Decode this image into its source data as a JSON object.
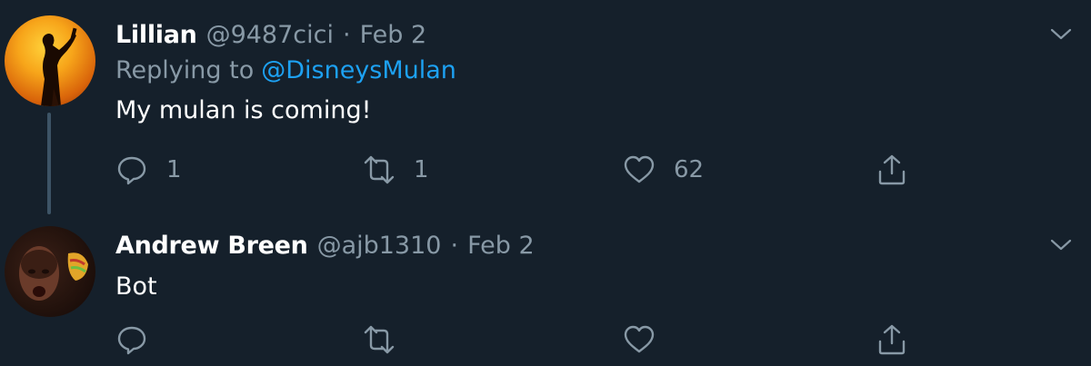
{
  "tweets": [
    {
      "display_name": "Lillian",
      "handle": "@9487cici",
      "separator": "·",
      "date": "Feb 2",
      "replying_prefix": "Replying to",
      "replying_to": "@DisneysMulan",
      "text": "My mulan is coming!",
      "reply_count": "1",
      "retweet_count": "1",
      "like_count": "62"
    },
    {
      "display_name": "Andrew Breen",
      "handle": "@ajb1310",
      "separator": "·",
      "date": "Feb 2",
      "text": "Bot"
    }
  ],
  "icons": {
    "reply": "reply-icon",
    "retweet": "retweet-icon",
    "like": "heart-icon",
    "share": "share-icon",
    "caret": "chevron-down-icon"
  },
  "colors": {
    "background": "#15202b",
    "text_primary": "#ffffff",
    "text_secondary": "#8899a6",
    "link": "#1da1f2",
    "thread_line": "#3d5466"
  }
}
